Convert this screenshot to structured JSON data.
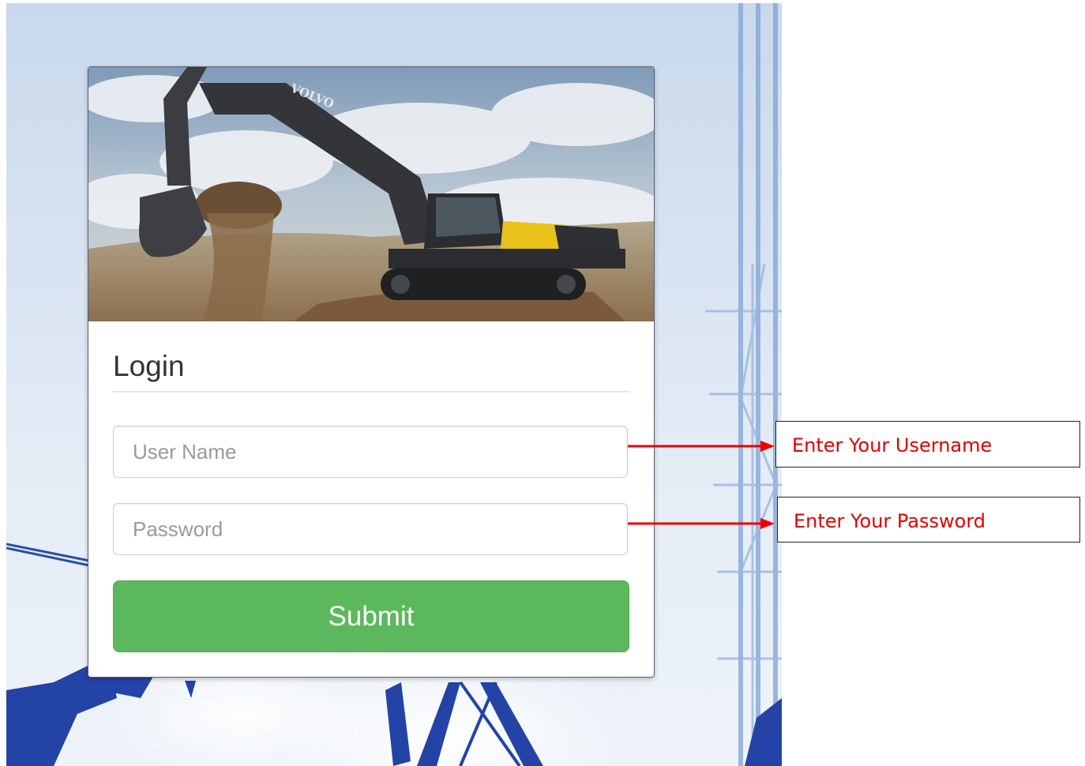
{
  "login": {
    "hero_brand": "VOLVO",
    "title": "Login",
    "username_placeholder": "User Name",
    "password_placeholder": "Password",
    "submit_label": "Submit"
  },
  "annotations": {
    "username_note": "Enter Your Username",
    "password_note": "Enter Your Password",
    "note_color": "#e00000"
  },
  "colors": {
    "submit_green": "#5cb85c",
    "arrow_red": "#ee0000"
  }
}
